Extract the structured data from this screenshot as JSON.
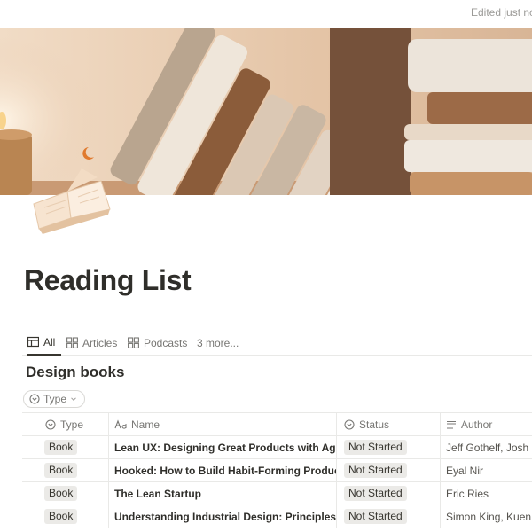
{
  "page": {
    "edited": "Edited just no",
    "title": "Reading List",
    "icon": "open-book-icon"
  },
  "tabs": [
    {
      "label": "All",
      "icon": "table-icon",
      "active": true
    },
    {
      "label": "Articles",
      "icon": "gallery-icon",
      "active": false
    },
    {
      "label": "Podcasts",
      "icon": "gallery-icon",
      "active": false
    },
    {
      "label": "3 more...",
      "icon": "",
      "active": false
    }
  ],
  "view": {
    "title": "Design books",
    "filter_label": "Type"
  },
  "table": {
    "columns": [
      {
        "label": "Type",
        "icon": "select-property-icon"
      },
      {
        "label": "Name",
        "icon": "text-property-icon"
      },
      {
        "label": "Status",
        "icon": "select-property-icon"
      },
      {
        "label": "Author",
        "icon": "list-property-icon"
      }
    ],
    "rows": [
      {
        "type": "Book",
        "name": "Lean UX: Designing Great Products with Agile Te",
        "status": "Not Started",
        "author": "Jeff Gothelf, Josh S"
      },
      {
        "type": "Book",
        "name": "Hooked: How to Build Habit-Forming Products",
        "status": "Not Started",
        "author": "Eyal Nir"
      },
      {
        "type": "Book",
        "name": "The Lean Startup",
        "status": "Not Started",
        "author": "Eric Ries"
      },
      {
        "type": "Book",
        "name": "Understanding Industrial Design: Principles for U",
        "status": "Not Started",
        "author": "Simon King, Kuen C"
      }
    ]
  },
  "colors": {
    "text": "#37352f",
    "muted": "#787774",
    "chip_bg": "#ebeae7",
    "border": "#e9e9e7",
    "cover_bg": "#e9ccb0"
  }
}
